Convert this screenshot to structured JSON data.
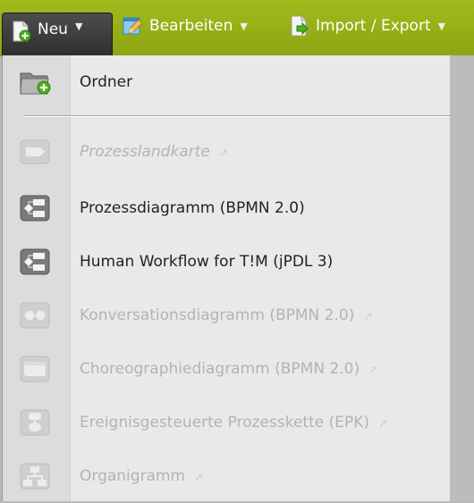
{
  "toolbar": {
    "new_label": "Neu",
    "new_icon": "new-document-icon",
    "edit_label": "Bearbeiten",
    "edit_icon": "edit-icon",
    "import_label": "Import / Export",
    "import_icon": "import-export-icon",
    "accent": "#97ae17"
  },
  "menu": {
    "items": [
      {
        "label": "Ordner",
        "icon": "folder-add-icon",
        "enabled": true
      },
      {
        "label": "Prozesslandkarte",
        "icon": "process-map-icon",
        "enabled": false
      },
      {
        "label": "Prozessdiagramm (BPMN 2.0)",
        "icon": "bpmn-diagram-icon",
        "enabled": true
      },
      {
        "label": "Human Workflow for T!M (jPDL 3)",
        "icon": "workflow-icon",
        "enabled": true
      },
      {
        "label": "Konversationsdiagramm (BPMN 2.0)",
        "icon": "conversation-diagram-icon",
        "enabled": false
      },
      {
        "label": "Choreographiediagramm (BPMN 2.0)",
        "icon": "choreography-diagram-icon",
        "enabled": false
      },
      {
        "label": "Ereignisgesteuerte Prozesskette (EPK)",
        "icon": "epc-diagram-icon",
        "enabled": false
      },
      {
        "label": "Organigramm",
        "icon": "org-chart-icon",
        "enabled": false
      }
    ]
  }
}
